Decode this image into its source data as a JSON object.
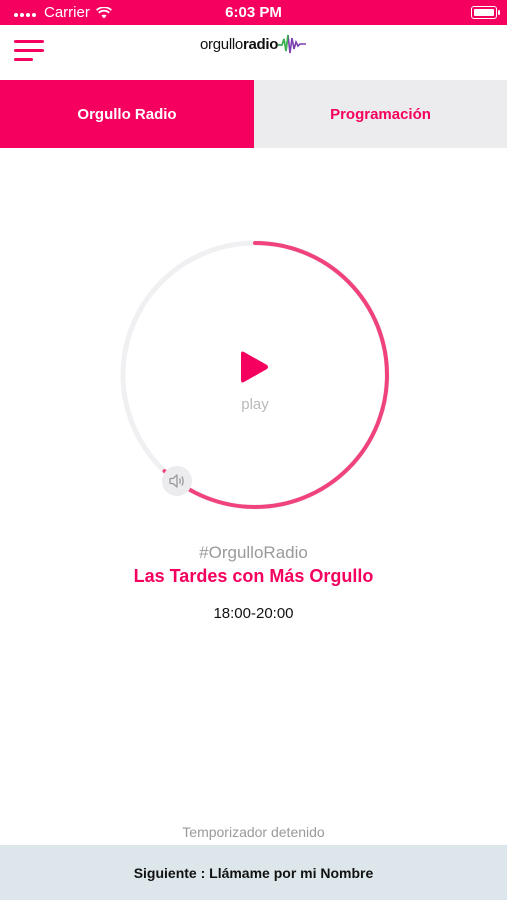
{
  "status_bar": {
    "carrier": "Carrier",
    "time": "6:03 PM",
    "battery_level": 1.0,
    "wifi_icon": "wifi-icon"
  },
  "header": {
    "menu_icon": "hamburger-menu-icon",
    "logo_text_light": "orgullo",
    "logo_text_bold": "radio"
  },
  "tabs": [
    {
      "label": "Orgullo Radio",
      "active": true
    },
    {
      "label": "Programación",
      "active": false
    }
  ],
  "player": {
    "play_label": "play",
    "progress": 0.62,
    "play_icon": "play-icon",
    "volume_icon": "volume-icon"
  },
  "now_playing": {
    "hashtag": "#OrgulloRadio",
    "show_title": "Las Tardes con Más Orgullo",
    "schedule": "18:00-20:00"
  },
  "footer": {
    "timer_status": "Temporizador detenido",
    "next_show": "Siguiente : Llámame por mi Nombre"
  },
  "colors": {
    "accent": "#f5005f",
    "tab_inactive_bg": "#ececee",
    "footer_bg": "#dde6ea"
  }
}
